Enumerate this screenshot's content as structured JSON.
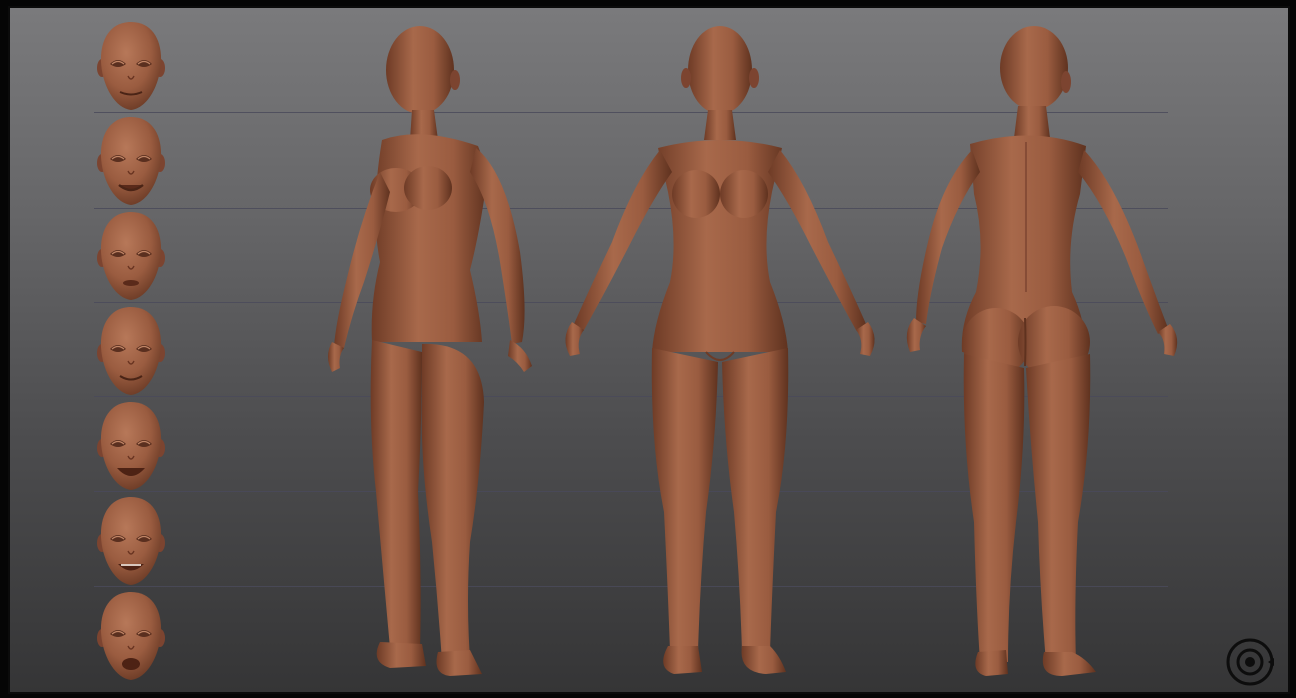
{
  "scene": {
    "skin_color": "#9a5c40",
    "skin_shadow": "#6e3b26",
    "skin_highlight": "#b77859",
    "guide_line_color": "#4a4a5a",
    "head_expressions": [
      "neutral",
      "smile",
      "pursed",
      "soft-smile",
      "wide-smile",
      "grin",
      "open-mouth"
    ],
    "views": [
      "three-quarter",
      "front",
      "back"
    ]
  },
  "logo": {
    "icon": "orbit-target-icon"
  }
}
